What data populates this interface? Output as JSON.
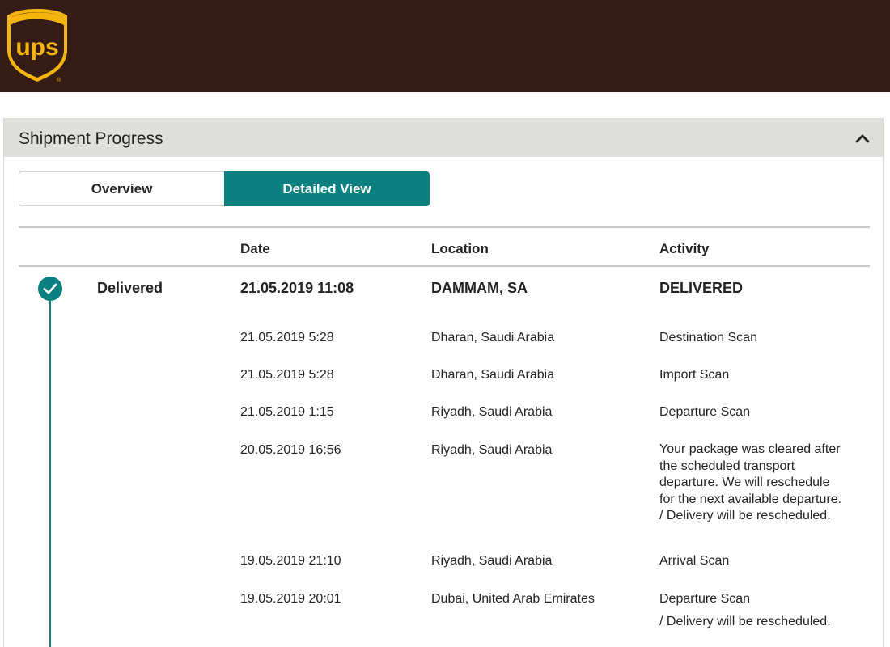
{
  "brand": {
    "logo_text": "ups",
    "registered_mark": "®",
    "bar_color": "#351c15"
  },
  "panel": {
    "title": "Shipment Progress",
    "collapse_icon": "chevron-up-icon"
  },
  "tabs": [
    {
      "label": "Overview",
      "active": false
    },
    {
      "label": "Detailed View",
      "active": true
    }
  ],
  "columns": {
    "date": "Date",
    "location": "Location",
    "activity": "Activity"
  },
  "status": {
    "label": "Delivered",
    "icon": "check-circle-icon",
    "color": "#0a8080"
  },
  "events": [
    {
      "date": "21.05.2019  11:08",
      "location": "DAMMAM, SA",
      "activity": "DELIVERED",
      "highlight": true
    },
    {
      "date": "21.05.2019  5:28",
      "location": "Dharan, Saudi Arabia",
      "activity": "Destination Scan"
    },
    {
      "date": "21.05.2019  5:28",
      "location": "Dharan, Saudi Arabia",
      "activity": "Import Scan"
    },
    {
      "date": "21.05.2019  1:15",
      "location": "Riyadh, Saudi Arabia",
      "activity": "Departure Scan"
    },
    {
      "date": "20.05.2019  16:56",
      "location": "Riyadh, Saudi Arabia",
      "activity_lines": [
        "Your package was cleared after",
        "the scheduled transport",
        "departure. We will reschedule",
        "for the next available departure.",
        "/ Delivery will be rescheduled."
      ]
    },
    {
      "date": "19.05.2019  21:10",
      "location": "Riyadh, Saudi Arabia",
      "activity": "Arrival Scan"
    },
    {
      "date": "19.05.2019  20:01",
      "location": "Dubai, United Arab Emirates",
      "activity": "Departure Scan",
      "activity_note": "/ Delivery will be rescheduled."
    }
  ]
}
